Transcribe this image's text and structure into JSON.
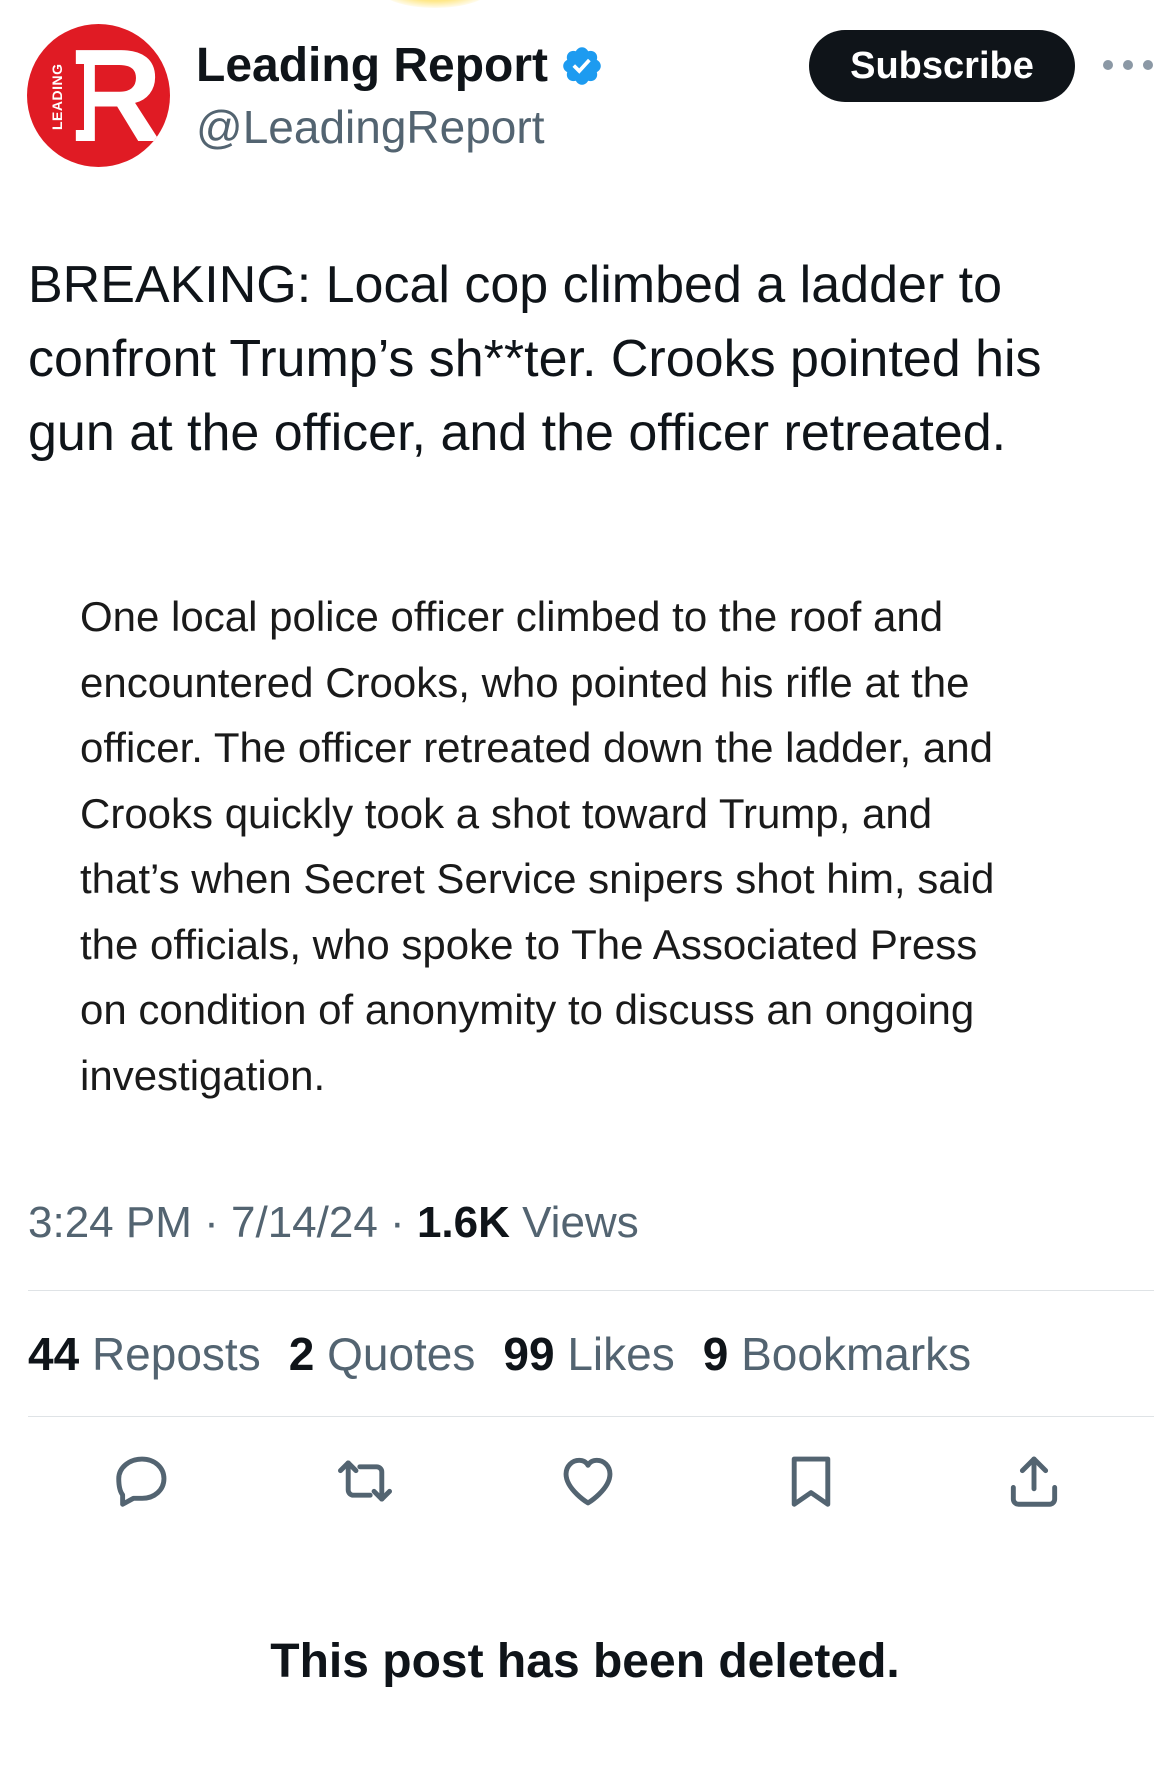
{
  "author": {
    "name": "Leading Report",
    "handle": "@LeadingReport",
    "avatar_letter": "R",
    "avatar_side_text": "LEADING",
    "verified": true,
    "brand_color": "#e01b24",
    "verified_color": "#1d9bf0"
  },
  "header": {
    "subscribe_label": "Subscribe",
    "more_icon": "more-dots-icon"
  },
  "tweet": {
    "text": "BREAKING: Local cop climbed a ladder to\nconfront Trump’s sh**ter. Crooks pointed his\ngun at the officer, and the officer retreated.",
    "quoted_image_text": "One local police officer climbed to the roof and\nencountered Crooks, who pointed his rifle at the\nofficer. The officer retreated down the ladder, and\nCrooks quickly took a shot toward Trump, and\nthat’s when Secret Service snipers shot him, said\nthe officials, who spoke to The Associated Press\non condition of anonymity to discuss an ongoing\ninvestigation."
  },
  "meta": {
    "time": "3:24 PM",
    "date": "7/14/24",
    "separator": "·",
    "views_count": "1.6K",
    "views_label": "Views"
  },
  "stats": [
    {
      "count": "44",
      "label": "Reposts"
    },
    {
      "count": "2",
      "label": "Quotes"
    },
    {
      "count": "99",
      "label": "Likes"
    },
    {
      "count": "9",
      "label": "Bookmarks"
    }
  ],
  "actions": [
    {
      "name": "reply",
      "icon": "reply-icon"
    },
    {
      "name": "repost",
      "icon": "repost-icon"
    },
    {
      "name": "like",
      "icon": "heart-icon"
    },
    {
      "name": "bookmark",
      "icon": "bookmark-icon"
    },
    {
      "name": "share",
      "icon": "share-icon"
    }
  ],
  "footer": {
    "deleted_notice": "This post has been deleted."
  }
}
